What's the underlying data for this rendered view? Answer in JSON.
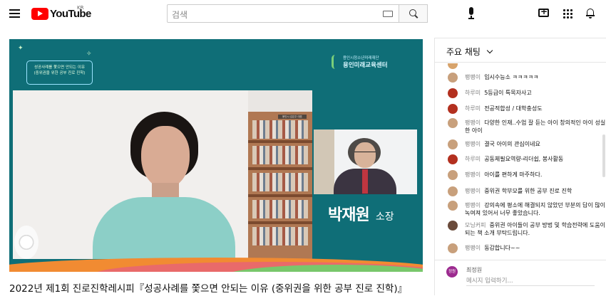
{
  "header": {
    "logo_text": "YouTube",
    "region": "KR",
    "search_placeholder": "검색",
    "icons": [
      "menu-icon",
      "keyboard-icon",
      "search-icon",
      "mic-icon",
      "create-icon",
      "apps-icon",
      "notifications-icon"
    ]
  },
  "video": {
    "title": "2022년 제1회 진로진학레시피『성공사례를 쫓으면 안되는 이유 (중위권을 위한 공부 진로 진학)』",
    "slide_text": "성공사례를 쫓으면 안되는 이유\n(중위권을 위한 공부 진로 진학)",
    "org_sub": "용인시청소년미래재단",
    "org_name": "용인미래교육센터",
    "camera_tag": "용인시 김은주 대표",
    "guest_name": "박재원",
    "guest_title": "소장",
    "colors": {
      "background": "#0f6e77",
      "accent_orange": "#f18b32",
      "accent_green": "#79c76b"
    }
  },
  "chat": {
    "header": "주요 채팅",
    "messages": [
      {
        "name": "",
        "text": "",
        "avatar": "#d7a36b"
      },
      {
        "name": "팽팽이",
        "text": "입시수능소 ㅋㅋㅋㅋㅋ",
        "avatar": "#c8a07c"
      },
      {
        "name": "하루미",
        "text": "5등급이 특목자사고",
        "avatar": "#b3301f"
      },
      {
        "name": "하루미",
        "text": "전공적합성 / 대학충성도",
        "avatar": "#b3301f"
      },
      {
        "name": "팽팽이",
        "text": "다양한 인재..수업 잘 듣는 아이 창의적인 아이 성실한 아이",
        "avatar": "#c8a07c"
      },
      {
        "name": "팽팽이",
        "text": "결국 아이의 관심이네요",
        "avatar": "#c8a07c"
      },
      {
        "name": "하루미",
        "text": "공동체필요역량-리더쉽, 봉사활동",
        "avatar": "#b3301f"
      },
      {
        "name": "팽팽이",
        "text": "아이를 편하게 마주하다.",
        "avatar": "#c8a07c"
      },
      {
        "name": "팽팽이",
        "text": "중위권 학부모를 위한 공부 진로 진학",
        "avatar": "#c8a07c"
      },
      {
        "name": "팽팽이",
        "text": "강의속에 평소에 해결되지 않았던 부분의 답이 많이 녹여져 있어서 너무 좋았습니다.",
        "avatar": "#c8a07c"
      },
      {
        "name": "모닝커피",
        "text": "중위권 아이들이 공부 방법 및 학습전략에 도움이 되는 책 소개 부탁드립니다.",
        "avatar": "#6a4b3b"
      },
      {
        "name": "팽팽이",
        "text": "동감합니다~~",
        "avatar": "#c8a07c"
      }
    ],
    "me_avatar_label": "최정원",
    "me_name": "최정원",
    "input_placeholder": "메시지 입력하기..."
  }
}
